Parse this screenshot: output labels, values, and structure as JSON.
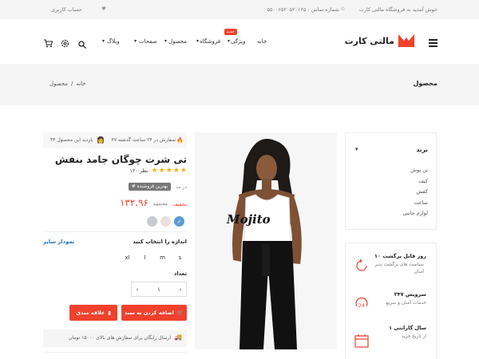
{
  "topbar": {
    "welcome": "خوش آمدید به فروشگاه مالتی کارت",
    "phone": "شماره تماس : ۵۵۰۰۶۵۲۰۵۲۰۱۲۵",
    "account": "حساب کاربری"
  },
  "header": {
    "logo_text": "مالتی کارت",
    "nav": {
      "home": "خانه",
      "features": "ویژگی",
      "shop": "فروشگاه",
      "shop_badge": "جدید",
      "product": "محصول",
      "pages": "صفحات",
      "blog": "وبلاگ"
    }
  },
  "page_header": {
    "title": "محصول",
    "breadcrumb_home": "خانه",
    "breadcrumb_sep": "/",
    "breadcrumb_current": "محصول"
  },
  "sidebar": {
    "brand_title": "برند",
    "brands": [
      "تن پوش",
      "کیف",
      "کفش",
      "ساعت",
      "لوازم جانبی"
    ],
    "services": [
      {
        "title": "۱۰ روز قابل برگشت",
        "subtitle": "سیاست های برگشت پذیر آسان"
      },
      {
        "title": "سرویس ۲۴۷",
        "subtitle": "خدمات آسان و سریع"
      },
      {
        "title": "۱ سال گارانتی",
        "subtitle": "از تاریخ خرید"
      }
    ]
  },
  "product": {
    "image_caption": "Mojito",
    "sold_info": "۳۷ سفارش در ۲۴ ساعت گذشته",
    "viewers_info": "۴۴ بازدید این محصول",
    "title": "تی شرت چوگان جامد بنفش",
    "rating": 4.5,
    "reviews": "۱۲۰ نظر",
    "badge": "# بهترین فروشنده",
    "badge_suffix": "در مد",
    "price": "۱۳۲.۹۶",
    "old_price": "۱۵۷.۹۶",
    "discount_label": "تخفیف",
    "colors": [
      "#5b9bd5",
      "#ece0dc",
      "#c8cbd0"
    ],
    "size_label": "اندازه را انتخاب کنید",
    "size_chart": "نمودار سایز",
    "sizes": [
      "s",
      "m",
      "l",
      "xl"
    ],
    "qty_label": "تعداد",
    "qty_value": "۱",
    "add_to_cart": "اضافه کردن به سبد",
    "wishlist": "علاقه مندی",
    "shipping": "ارسال رایگان برای سفارش های بالای ۱۵۰۰۰ تومان"
  },
  "colors": {
    "accent": "#f0412d",
    "dark": "#222222",
    "link": "#1e73be"
  }
}
